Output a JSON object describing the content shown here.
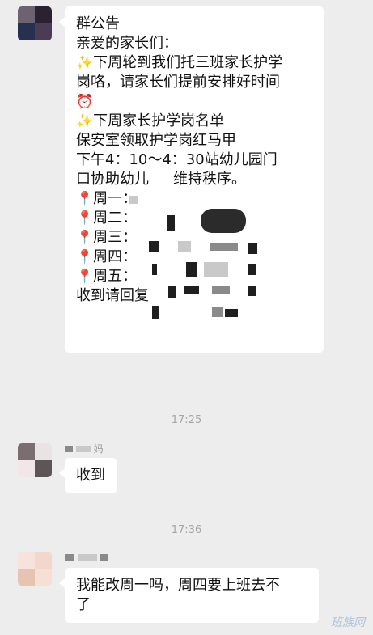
{
  "announcement": {
    "title": "群公告",
    "greeting": "亲爱的家长们：",
    "line1": "下周轮到我们托三班家长护学",
    "line2": "岗咯，请家长们提前安排好时间",
    "line3": "下周家长护学岗名单",
    "line4": "保安室领取护学岗红马甲",
    "line5": "下午4：10～4：30站幼儿园门",
    "line6": "口协助幼儿",
    "line6b": "维持秩序。",
    "days": [
      "周一：",
      "周二：",
      "周三：",
      "周四：",
      "周五："
    ],
    "footer": "收到请回复"
  },
  "icons": {
    "sparkle": "✨",
    "clock": "⏰",
    "pin": "📍"
  },
  "messages": [
    {
      "time": "17:25",
      "sender_suffix": "妈",
      "text": "收到"
    },
    {
      "time": "17:36",
      "text_line1": "我能改周一吗，周四要上班去不",
      "text_line2": "了"
    }
  ],
  "watermark": "班族网"
}
